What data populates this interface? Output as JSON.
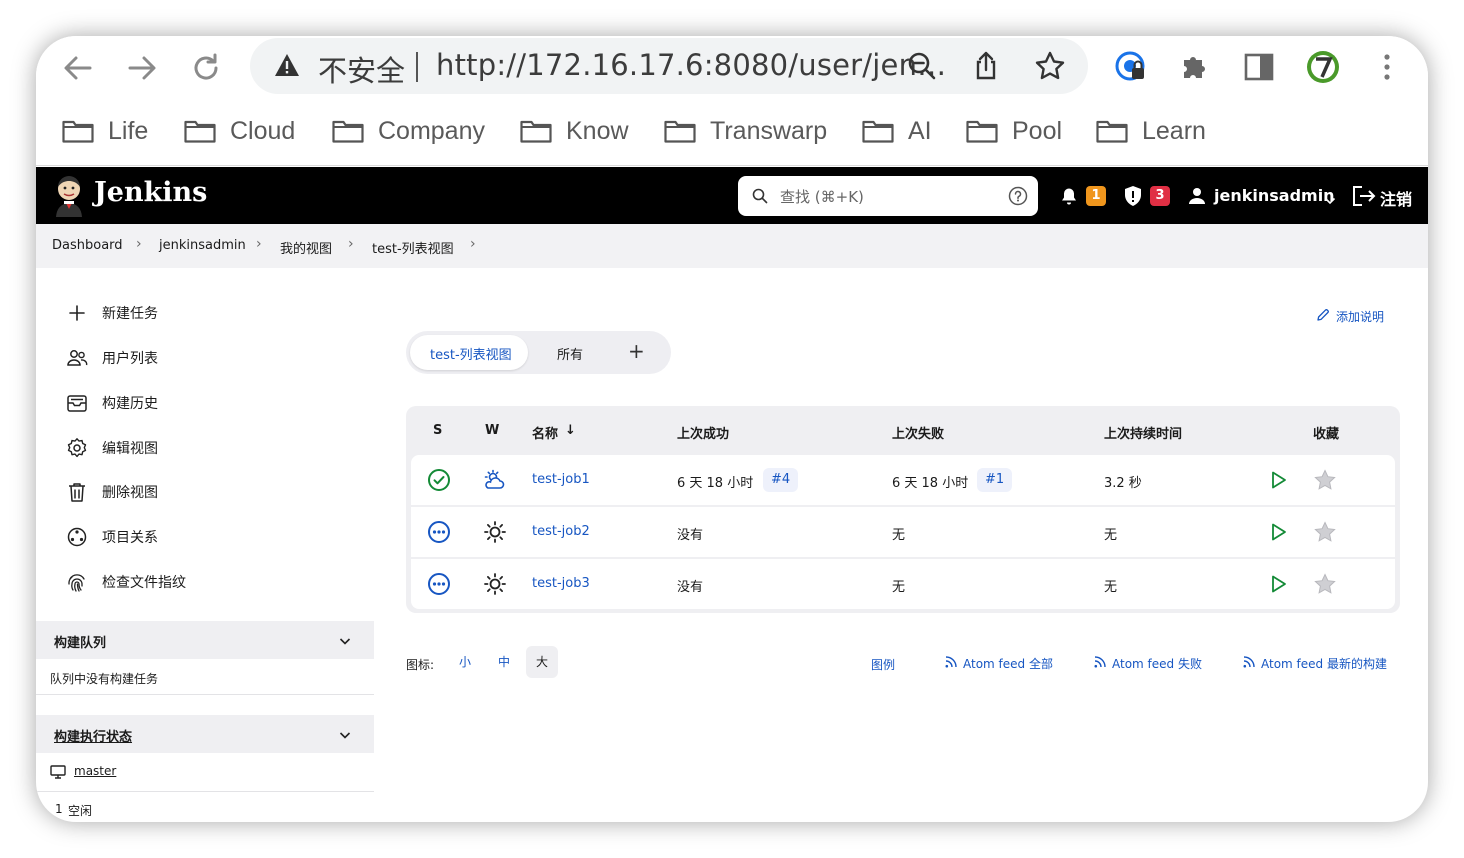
{
  "browser": {
    "back_icon": "arrow-left-icon",
    "forward_icon": "arrow-right-icon",
    "reload_icon": "reload-icon",
    "security_label": "不安全",
    "url": "http://172.16.17.6:8080/user/jen…",
    "bookmarks": [
      "Life",
      "Cloud",
      "Company",
      "Know",
      "Transwarp",
      "AI",
      "Pool",
      "Learn"
    ]
  },
  "jenkins": {
    "brand": "Jenkins",
    "search_placeholder": "查找 (⌘+K)",
    "notifications_count": "1",
    "security_count": "3",
    "username": "jenkinsadmin",
    "logout": "注销",
    "accent_orange": "#f0961d",
    "accent_red": "#e02f44",
    "link_color": "#1756c2"
  },
  "breadcrumb": [
    "Dashboard",
    "jenkinsadmin",
    "我的视图",
    "test-列表视图"
  ],
  "sidebar": {
    "items": [
      {
        "label": "新建任务",
        "icon": "plus-icon"
      },
      {
        "label": "用户列表",
        "icon": "users-icon"
      },
      {
        "label": "构建历史",
        "icon": "build-history-icon"
      },
      {
        "label": "编辑视图",
        "icon": "gear-icon"
      },
      {
        "label": "删除视图",
        "icon": "trash-icon"
      },
      {
        "label": "项目关系",
        "icon": "relationship-icon"
      },
      {
        "label": "检查文件指纹",
        "icon": "fingerprint-icon"
      }
    ],
    "queue_title": "构建队列",
    "queue_empty": "队列中没有构建任务",
    "executor_title": "构建执行状态",
    "executor_node": "master",
    "executor_slot": "1",
    "executor_slot_state": "空闲"
  },
  "main": {
    "add_description": "添加说明",
    "tabs": [
      {
        "label": "test-列表视图",
        "active": true
      },
      {
        "label": "所有",
        "active": false
      }
    ],
    "add_tab": "+",
    "table": {
      "headers": [
        "S",
        "W",
        "名称",
        "上次成功",
        "上次失败",
        "上次持续时间",
        "收藏"
      ],
      "sort_indicator": "↓",
      "rows": [
        {
          "status": "success",
          "weather": "cloudy",
          "name": "test-job1",
          "last_success": "6 天 18 小时",
          "last_success_build": "#4",
          "last_failure": "6 天 18 小时",
          "last_failure_build": "#1",
          "last_duration": "3.2 秒"
        },
        {
          "status": "not-built",
          "weather": "sunny",
          "name": "test-job2",
          "last_success": "没有",
          "last_success_build": "",
          "last_failure": "无",
          "last_failure_build": "",
          "last_duration": "无"
        },
        {
          "status": "not-built",
          "weather": "sunny",
          "name": "test-job3",
          "last_success": "没有",
          "last_success_build": "",
          "last_failure": "无",
          "last_failure_build": "",
          "last_duration": "无"
        }
      ]
    },
    "icon_label": "图标:",
    "icon_sizes": [
      "小",
      "中",
      "大"
    ],
    "icon_size_selected": "大",
    "legend": "图例",
    "feeds": [
      "Atom feed 全部",
      "Atom feed 失败",
      "Atom feed 最新的构建"
    ]
  }
}
